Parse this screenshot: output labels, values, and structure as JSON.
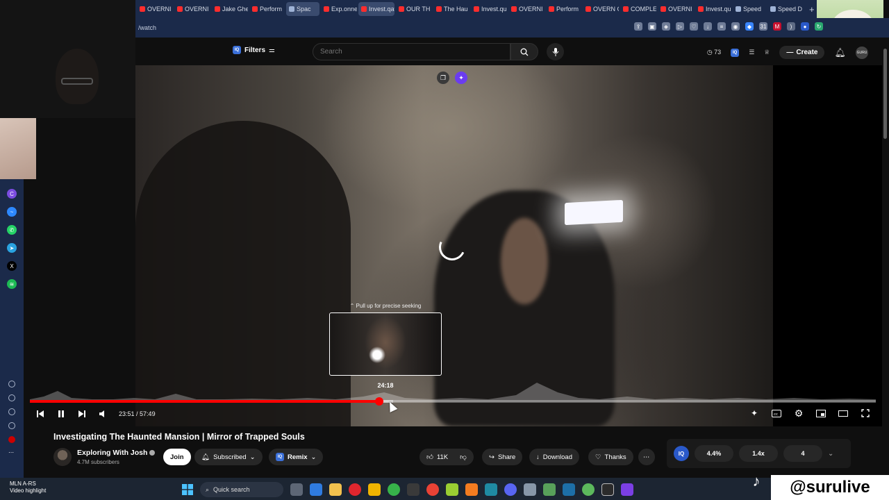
{
  "browser": {
    "tabs": [
      {
        "label": "OVERNI",
        "fav": "youtube"
      },
      {
        "label": "OVERNI",
        "fav": "youtube"
      },
      {
        "label": "Jake Ghe",
        "fav": "youtube"
      },
      {
        "label": "Perform",
        "fav": "youtube"
      },
      {
        "label": "Spac",
        "fav": "grid",
        "active": true
      },
      {
        "label": "Exp.onne",
        "fav": "youtube"
      },
      {
        "label": "Invest.qatar",
        "fav": "youtube",
        "active": true
      },
      {
        "label": "OUR TH",
        "fav": "youtube"
      },
      {
        "label": "The Hau",
        "fav": "youtube"
      },
      {
        "label": "Invest.qu",
        "fav": "youtube"
      },
      {
        "label": "OVERNI",
        "fav": "youtube"
      },
      {
        "label": "Perform",
        "fav": "youtube"
      },
      {
        "label": "OVERN G",
        "fav": "youtube"
      },
      {
        "label": "COMPLE",
        "fav": "youtube"
      },
      {
        "label": "OVERNI",
        "fav": "youtube"
      },
      {
        "label": "Invest.qu",
        "fav": "youtube"
      },
      {
        "label": "Speed",
        "fav": "grid"
      },
      {
        "label": "Speed D",
        "fav": "grid"
      }
    ],
    "new_tab": "+",
    "address": "/watch"
  },
  "header": {
    "filters_label": "Filters",
    "search_placeholder": "Search",
    "counter": "73",
    "create_label": "Create",
    "avatar_text": "GURU"
  },
  "player": {
    "preview_hint": "Pull up for precise seeking",
    "preview_time": "24:18",
    "current_time": "23:51",
    "duration": "57:49",
    "time_sep": " / ",
    "played_fraction": 0.4127,
    "buffer_fraction": 0.4295
  },
  "video": {
    "title": "Investigating The Haunted Mansion | Mirror of Trapped Souls",
    "channel": "Exploring With Josh",
    "subscribers": "4.7M subscribers",
    "join_label": "Join",
    "subscribed_label": "Subscribed",
    "remix_label": "Remix",
    "likes": "11K",
    "share_label": "Share",
    "download_label": "Download",
    "thanks_label": "Thanks"
  },
  "extension_panel": {
    "iq_label": "IQ",
    "cell1": "4.4%",
    "cell2": "1.4x",
    "cell3": "4"
  },
  "taskbar": {
    "weather_line1": "MLN  A-RS",
    "weather_line2": "Video highlight",
    "quick_search": "Quick search"
  },
  "watermark": "@surulive",
  "colors": {
    "accent_red": "#ff0000",
    "browser_bar": "#1b2a4a",
    "yt_bg": "#0f0f0f"
  }
}
